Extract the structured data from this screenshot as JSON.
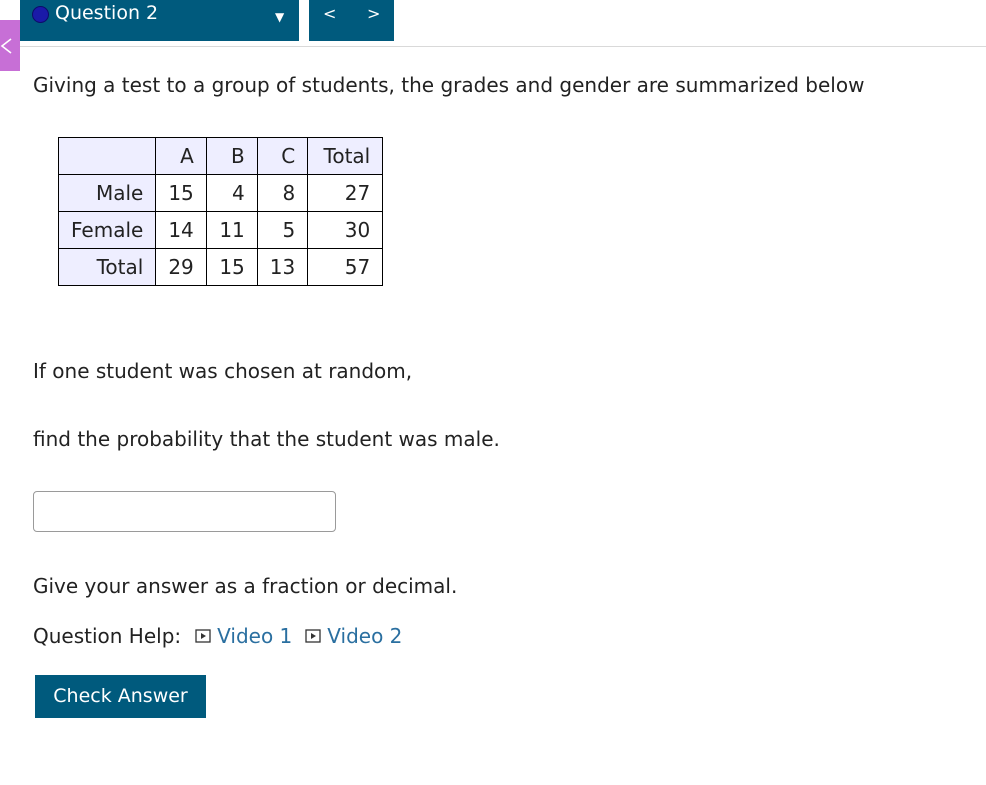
{
  "header": {
    "question_label": "Question 2",
    "prev_label": "<",
    "next_label": ">"
  },
  "question": {
    "intro": "Giving a test to a group of students, the grades and gender are summarized below",
    "table": {
      "headers": [
        "",
        "A",
        "B",
        "C",
        "Total"
      ],
      "rows": [
        [
          "Male",
          "15",
          "4",
          "8",
          "27"
        ],
        [
          "Female",
          "14",
          "11",
          "5",
          "30"
        ],
        [
          "Total",
          "29",
          "15",
          "13",
          "57"
        ]
      ]
    },
    "prompt_line1": "If one student was chosen at random,",
    "prompt_line2": "find the probability that the student was male.",
    "answer_value": "",
    "hint": "Give your answer as a fraction or decimal.",
    "help_label": "Question Help:",
    "video1_label": "Video 1",
    "video2_label": "Video 2",
    "check_label": "Check Answer"
  },
  "colors": {
    "header_bg": "#005a7d",
    "side_tab": "#c76fd6",
    "table_header_bg": "#eeeeff",
    "link": "#2a6fa0"
  },
  "icons": [
    "chevron-left-icon",
    "caret-down-icon",
    "video-icon"
  ]
}
